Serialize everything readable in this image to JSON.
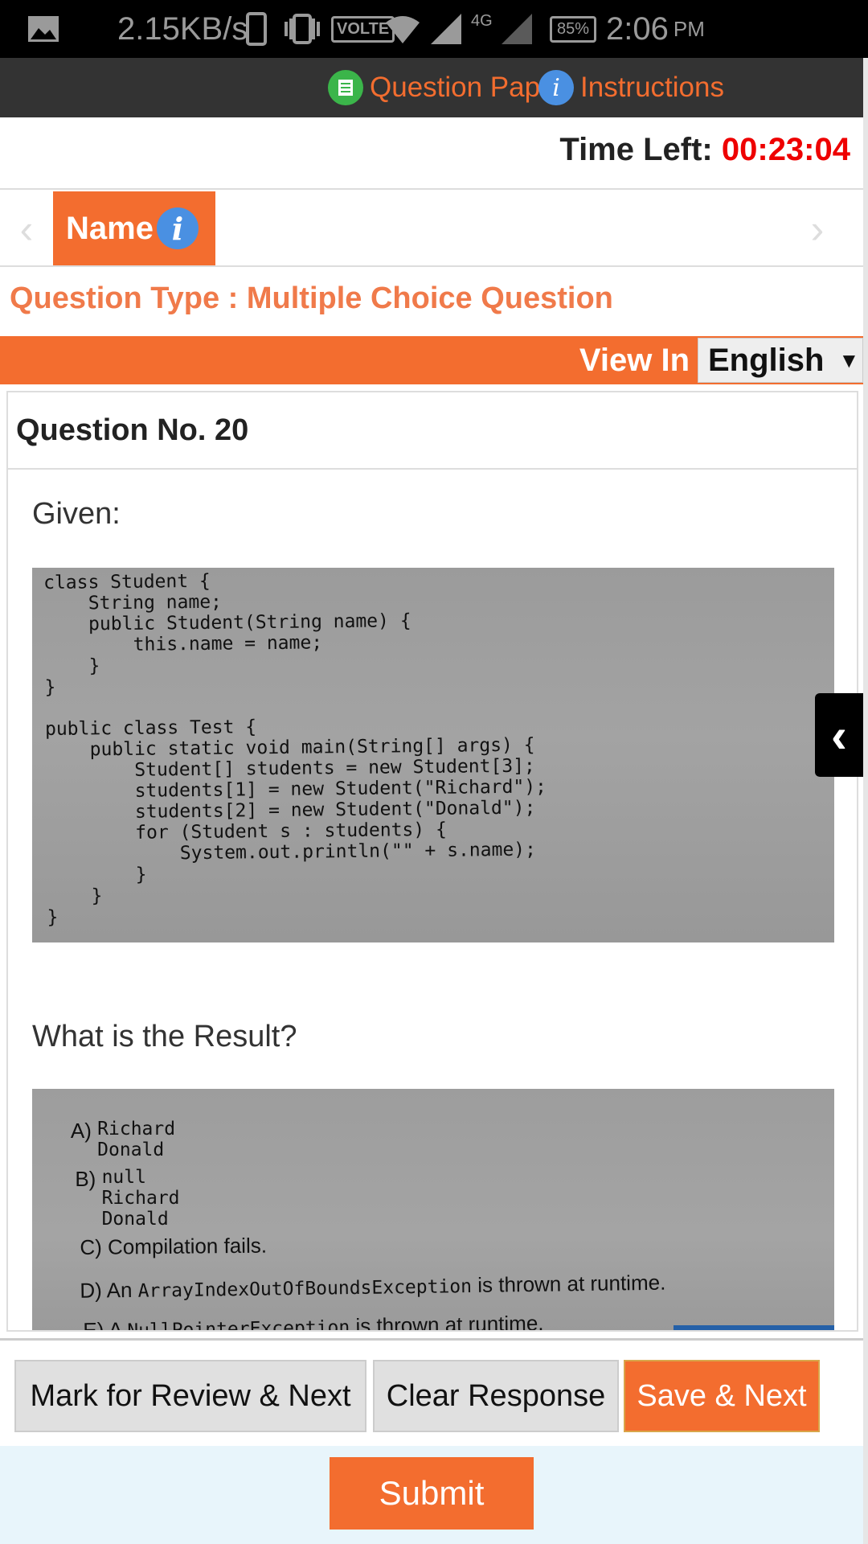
{
  "status_bar": {
    "speed": "2.15KB/s",
    "volte": "VOLTE",
    "network": "4G",
    "battery": "85%",
    "time": "2:06",
    "ampm": "PM"
  },
  "top_bar": {
    "question_paper_label": "Question Paper",
    "instructions_label": "Instructions"
  },
  "timer": {
    "label": "Time Left:",
    "value": "00:23:04"
  },
  "section_tab": {
    "name": "Name",
    "info_glyph": "i"
  },
  "question_type": "Question Type : Multiple Choice Question",
  "view_in": {
    "label": "View In",
    "language": "English"
  },
  "question": {
    "number_label": "Question No. 20",
    "given": "Given:",
    "code": "class Student {\n    String name;\n    public Student(String name) {\n        this.name = name;\n    }\n}\n\npublic class Test {\n    public static void main(String[] args) {\n        Student[] students = new Student[3];\n        students[1] = new Student(\"Richard\");\n        students[2] = new Student(\"Donald\");\n        for (Student s : students) {\n            System.out.println(\"\" + s.name);\n        }\n    }\n}",
    "prompt": "What is the Result?",
    "options": [
      {
        "key": "A)",
        "text": "Richard\nDonald"
      },
      {
        "key": "B)",
        "text": "null\nRichard\nDonald"
      },
      {
        "key": "C)",
        "text": "Compilation fails."
      },
      {
        "key": "D)",
        "pre": "An ",
        "mono": "ArrayIndexOutOfBoundsException",
        "post": " is thrown at runtime."
      },
      {
        "key": "E)",
        "pre": "A ",
        "mono": "NullPointerException",
        "post": " is thrown at runtime."
      }
    ]
  },
  "buttons": {
    "mark_review": "Mark for Review & Next",
    "clear": "Clear Response",
    "save_next": "Save & Next",
    "submit": "Submit"
  },
  "colors": {
    "accent": "#f36d2f",
    "timer": "#e00000",
    "info_blue": "#4a90e2",
    "topbar": "#333333"
  }
}
